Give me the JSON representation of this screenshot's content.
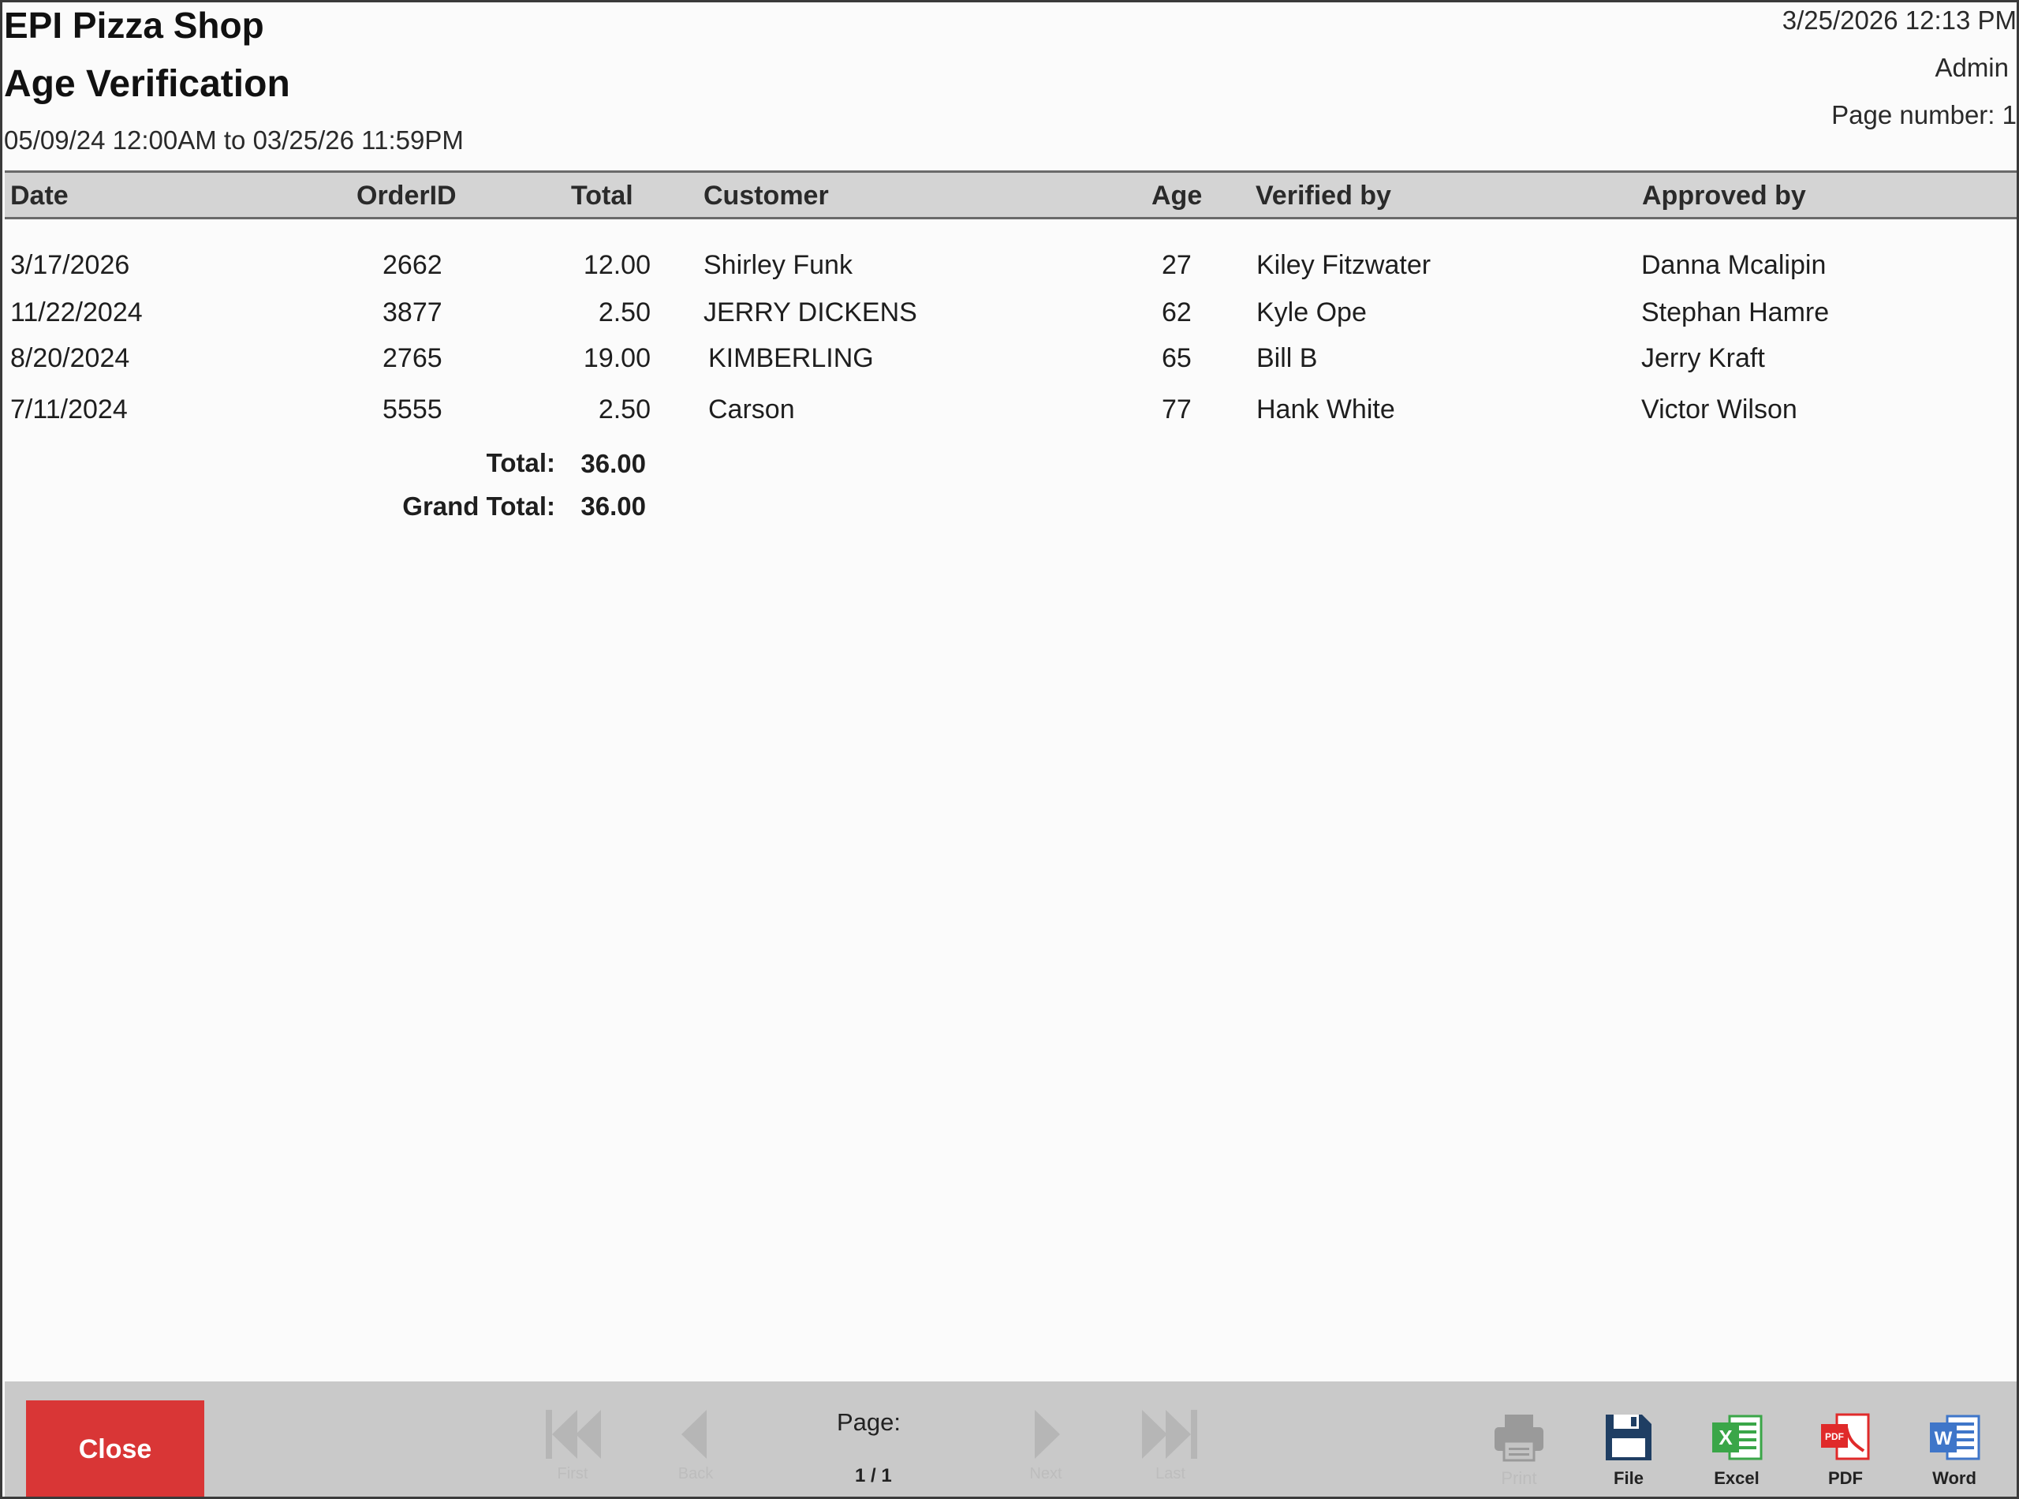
{
  "header": {
    "shop_name": "EPI Pizza Shop",
    "report_title": "Age Verification",
    "date_range": "05/09/24 12:00AM to 03/25/26 11:59PM",
    "print_datetime": "3/25/2026 12:13 PM",
    "print_user": "Admin",
    "page_number": "Page number: 1"
  },
  "table": {
    "columns": [
      "Date",
      "OrderID",
      "Total",
      "Customer",
      "Age",
      "Verified by",
      "Approved by"
    ],
    "rows": [
      {
        "date": "3/17/2026",
        "order_id": "2662",
        "total": "12.00",
        "customer": "Shirley Funk",
        "age": "27",
        "verified_by": "Kiley Fitzwater",
        "approved_by": "Danna Mcalipin"
      },
      {
        "date": "11/22/2024",
        "order_id": "3877",
        "total": "2.50",
        "customer": "JERRY DICKENS",
        "age": "62",
        "verified_by": "Kyle Ope",
        "approved_by": "Stephan Hamre"
      },
      {
        "date": "8/20/2024",
        "order_id": "2765",
        "total": "19.00",
        "customer": "KIMBERLING",
        "age": "65",
        "verified_by": "Bill B",
        "approved_by": "Jerry Kraft"
      },
      {
        "date": "7/11/2024",
        "order_id": "5555",
        "total": "2.50",
        "customer": "Carson",
        "age": "77",
        "verified_by": "Hank White",
        "approved_by": "Victor Wilson"
      }
    ]
  },
  "summary": {
    "total_label": "Total:",
    "total_value": "36.00",
    "grand_total_label": "Grand Total:",
    "grand_total_value": "36.00"
  },
  "toolbar": {
    "close_label": "Close",
    "nav": {
      "first": "First",
      "back": "Back",
      "next": "Next",
      "last": "Last"
    },
    "page_label": "Page:",
    "page_value": "1 / 1",
    "tools": {
      "print": "Print",
      "file": "File",
      "excel": "Excel",
      "pdf": "PDF",
      "word": "Word"
    }
  },
  "colors": {
    "close_button": "#d93636",
    "excel_icon": "#3aa648",
    "pdf_icon": "#e02a2a",
    "word_icon": "#3f76c9",
    "file_icon": "#1f3e63"
  }
}
